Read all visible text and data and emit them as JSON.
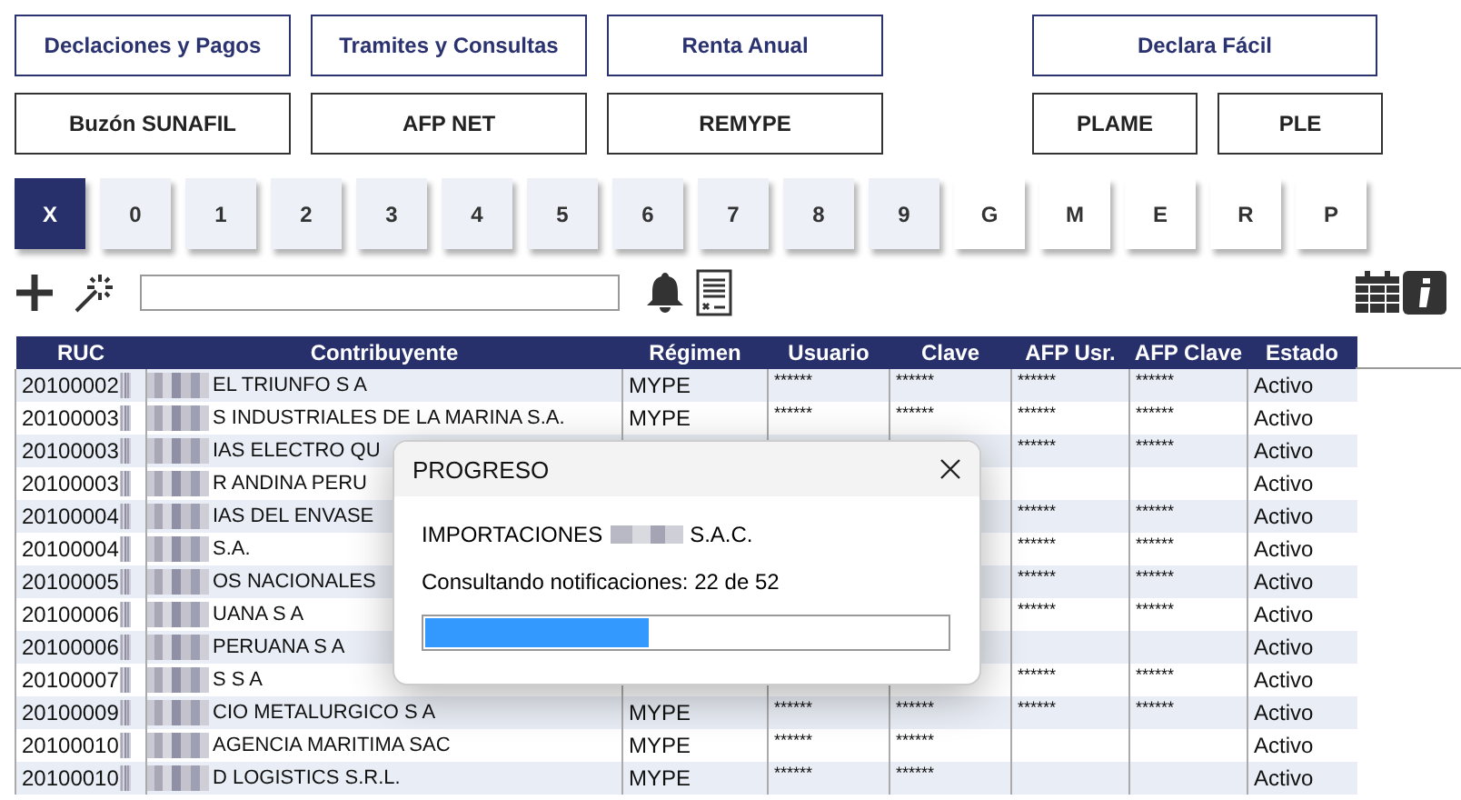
{
  "top_buttons": [
    {
      "label": "Declaciones y Pagos",
      "kind": "primary"
    },
    {
      "label": "Tramites y Consultas",
      "kind": "primary"
    },
    {
      "label": "Renta Anual",
      "kind": "primary"
    },
    {
      "label": "Declara Fácil",
      "kind": "primary"
    }
  ],
  "second_buttons": [
    {
      "label": "Buzón SUNAFIL",
      "kind": "secondary"
    },
    {
      "label": "AFP NET",
      "kind": "secondary"
    },
    {
      "label": "REMYPE",
      "kind": "secondary"
    },
    {
      "label": "PLAME",
      "kind": "secondary"
    },
    {
      "label": "PLE",
      "kind": "secondary"
    }
  ],
  "filter_keys": [
    {
      "label": "X",
      "kind": "clear",
      "selected": true
    },
    {
      "label": "0",
      "kind": "digit",
      "selected": false
    },
    {
      "label": "1",
      "kind": "digit",
      "selected": false
    },
    {
      "label": "2",
      "kind": "digit",
      "selected": false
    },
    {
      "label": "3",
      "kind": "digit",
      "selected": false
    },
    {
      "label": "4",
      "kind": "digit",
      "selected": false
    },
    {
      "label": "5",
      "kind": "digit",
      "selected": false
    },
    {
      "label": "6",
      "kind": "digit",
      "selected": false
    },
    {
      "label": "7",
      "kind": "digit",
      "selected": false
    },
    {
      "label": "8",
      "kind": "digit",
      "selected": false
    },
    {
      "label": "9",
      "kind": "digit",
      "selected": false
    },
    {
      "label": "G",
      "kind": "letter",
      "selected": false
    },
    {
      "label": "M",
      "kind": "letter",
      "selected": false
    },
    {
      "label": "E",
      "kind": "letter",
      "selected": false
    },
    {
      "label": "R",
      "kind": "letter",
      "selected": false
    },
    {
      "label": "P",
      "kind": "letter",
      "selected": false
    }
  ],
  "table": {
    "columns": [
      "RUC",
      "Contribuyente",
      "Régimen",
      "Usuario",
      "Clave",
      "AFP Usr.",
      "AFP Clave",
      "Estado"
    ],
    "rows": [
      {
        "ruc": "20100002",
        "contribuyente": "EL TRIUNFO S A",
        "regimen": "MYPE",
        "usuario": "******",
        "clave": "******",
        "afp_usr": "******",
        "afp_clave": "******",
        "estado": "Activo"
      },
      {
        "ruc": "20100003",
        "contribuyente": "S INDUSTRIALES DE LA MARINA S.A.",
        "regimen": "MYPE",
        "usuario": "******",
        "clave": "******",
        "afp_usr": "******",
        "afp_clave": "******",
        "estado": "Activo"
      },
      {
        "ruc": "20100003",
        "contribuyente": "IAS ELECTRO QU",
        "afp_usr": "******",
        "afp_clave": "******",
        "estado": "Activo"
      },
      {
        "ruc": "20100003",
        "contribuyente": "R ANDINA PERU",
        "estado": "Activo"
      },
      {
        "ruc": "20100004",
        "contribuyente": "IAS DEL ENVASE",
        "afp_usr": "******",
        "afp_clave": "******",
        "estado": "Activo"
      },
      {
        "ruc": "20100004",
        "contribuyente": "S.A.",
        "afp_usr": "******",
        "afp_clave": "******",
        "estado": "Activo"
      },
      {
        "ruc": "20100005",
        "contribuyente": "OS NACIONALES",
        "afp_usr": "******",
        "afp_clave": "******",
        "estado": "Activo"
      },
      {
        "ruc": "20100006",
        "contribuyente": "UANA S A",
        "afp_usr": "******",
        "afp_clave": "******",
        "estado": "Activo"
      },
      {
        "ruc": "20100006",
        "contribuyente": "PERUANA S A",
        "estado": "Activo"
      },
      {
        "ruc": "20100007",
        "contribuyente": "S S A",
        "afp_usr": "******",
        "afp_clave": "******",
        "estado": "Activo"
      },
      {
        "ruc": "20100009",
        "contribuyente": "CIO METALURGICO S A",
        "regimen": "MYPE",
        "usuario": "******",
        "clave": "******",
        "afp_usr": "******",
        "afp_clave": "******",
        "estado": "Activo"
      },
      {
        "ruc": "20100010",
        "contribuyente": "AGENCIA MARITIMA SAC",
        "regimen": "MYPE",
        "usuario": "******",
        "clave": "******",
        "estado": "Activo"
      },
      {
        "ruc": "20100010",
        "contribuyente": "D LOGISTICS S.R.L.",
        "regimen": "MYPE",
        "usuario": "******",
        "clave": "******",
        "estado": "Activo"
      }
    ]
  },
  "dialog": {
    "title": "PROGRESO",
    "company_prefix": "IMPORTACIONES",
    "company_suffix": "S.A.C.",
    "status": "Consultando notificaciones: 22 de 52",
    "level": 0.43
  }
}
